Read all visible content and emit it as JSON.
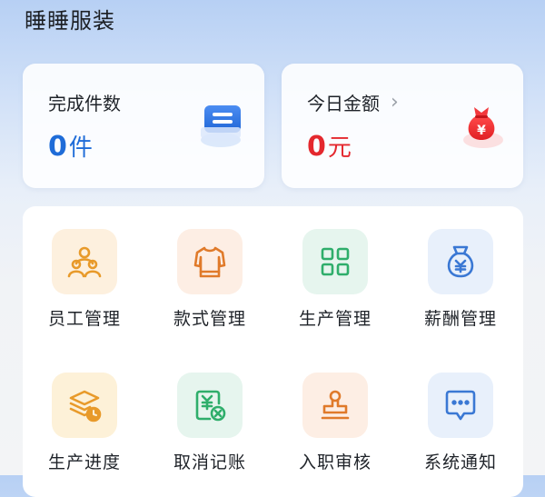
{
  "header": {
    "title": "睡睡服装"
  },
  "stats": {
    "completed": {
      "label": "完成件数",
      "value": "0",
      "unit": "件",
      "icon": "message-card-icon",
      "color": "#1f6cd8"
    },
    "today_amount": {
      "label": "今日金额",
      "value": "0",
      "unit": "元",
      "icon": "money-bag-icon",
      "color": "#e4282e",
      "chevron": "›"
    }
  },
  "menu": {
    "items": [
      {
        "label": "员工管理",
        "icon": "employees-icon"
      },
      {
        "label": "款式管理",
        "icon": "shirt-icon"
      },
      {
        "label": "生产管理",
        "icon": "grid-icon"
      },
      {
        "label": "薪酬管理",
        "icon": "salary-bag-icon"
      },
      {
        "label": "生产进度",
        "icon": "progress-layers-icon"
      },
      {
        "label": "取消记账",
        "icon": "cancel-bookkeeping-icon"
      },
      {
        "label": "入职审核",
        "icon": "stamp-icon"
      },
      {
        "label": "系统通知",
        "icon": "chat-notice-icon"
      }
    ]
  },
  "colors": {
    "accent_blue": "#1f6cd8",
    "accent_red": "#e4282e",
    "icon_orange": "#e89a2a",
    "icon_green": "#2fae6b",
    "icon_blue": "#3a78d4"
  }
}
